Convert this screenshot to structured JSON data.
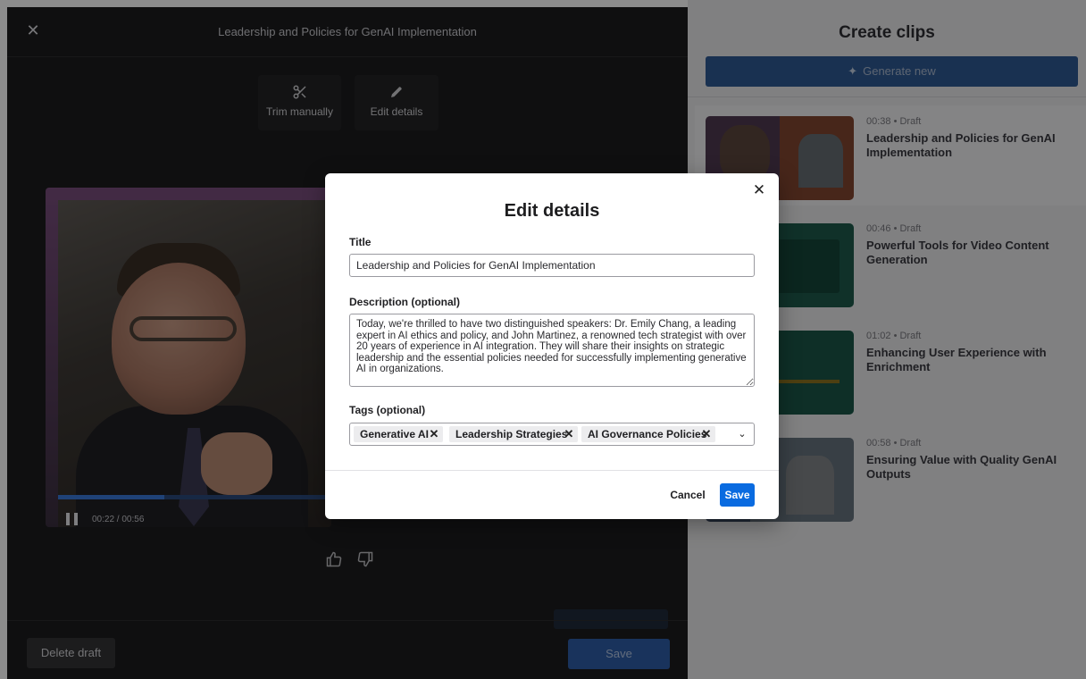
{
  "editor": {
    "title": "Leadership and Policies for GenAI Implementation",
    "close_icon": "close-icon",
    "tools": {
      "trim_label": "Trim manually",
      "edit_label": "Edit details"
    },
    "player": {
      "time": "00:22 / 00:56",
      "progress": 0.39
    },
    "delete_label": "Delete draft",
    "save_label": "Save"
  },
  "clips_panel": {
    "title": "Create clips",
    "generate_label": "Generate new",
    "items": [
      {
        "meta": "00:38 • Draft",
        "title": "Leadership and Policies for GenAI Implementation"
      },
      {
        "meta": "00:46 • Draft",
        "title": "Powerful Tools for Video Content Generation"
      },
      {
        "meta": "01:02 • Draft",
        "title": "Enhancing User Experience with Enrichment"
      },
      {
        "meta": "00:58 • Draft",
        "title": "Ensuring Value with Quality GenAI Outputs"
      }
    ]
  },
  "modal": {
    "title": "Edit details",
    "title_label": "Title",
    "title_value": "Leadership and Policies for GenAI Implementation",
    "description_label": "Description (optional)",
    "description_value": "Today, we're thrilled to have two distinguished speakers: Dr. Emily Chang, a leading expert in AI ethics and policy, and John Martinez, a renowned tech strategist with over 20 years of experience in AI integration. They will share their insights on strategic leadership and the essential policies needed for successfully implementing generative AI in organizations.",
    "tags_label": "Tags (optional)",
    "tags": [
      "Generative AI",
      "Leadership Strategies",
      "AI Governance Policies"
    ],
    "cancel_label": "Cancel",
    "save_label": "Save"
  },
  "colors": {
    "primary": "#0a6be0",
    "overlay": "rgba(0,0,0,0.45)"
  }
}
